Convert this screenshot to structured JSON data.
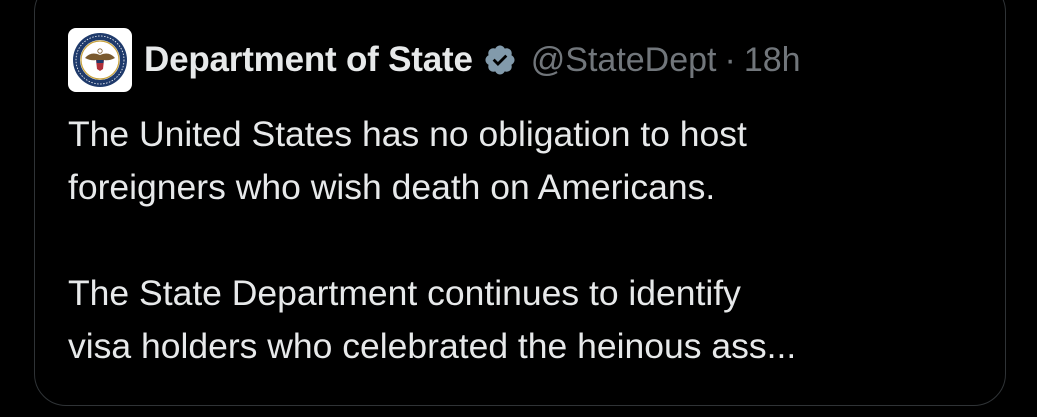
{
  "tweet": {
    "author": {
      "display_name": "Department of State",
      "verified": true,
      "verified_icon": "verified-badge-icon",
      "handle": "@StateDept",
      "separator": "·",
      "timestamp": "18h",
      "avatar_icon": "department-of-state-seal-icon"
    },
    "paragraphs": [
      "The United States has no obligation to host\nforeigners who wish death on Americans.",
      "The State Department continues to identify\nvisa holders who celebrated the heinous ass..."
    ]
  },
  "colors": {
    "background": "#000000",
    "text_primary": "#e7e9ea",
    "text_secondary": "#71767b",
    "card_border": "#2f3336",
    "verified_badge": "#829aab",
    "seal_blue": "#1f3a6b"
  }
}
